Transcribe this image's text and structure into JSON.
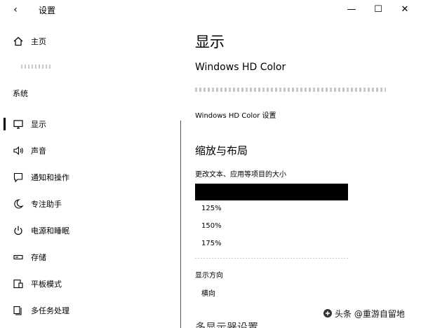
{
  "titlebar": {
    "back_glyph": "‹",
    "title": "设置",
    "minimize_glyph": "—",
    "maximize_glyph": "☐",
    "close_glyph": "✕"
  },
  "sidebar": {
    "home_label": "主页",
    "section_label": "系统",
    "items": [
      {
        "label": "显示",
        "icon": "monitor-icon",
        "active": true
      },
      {
        "label": "声音",
        "icon": "speaker-icon"
      },
      {
        "label": "通知和操作",
        "icon": "notification-icon"
      },
      {
        "label": "专注助手",
        "icon": "moon-icon"
      },
      {
        "label": "电源和睡眠",
        "icon": "power-icon"
      },
      {
        "label": "存储",
        "icon": "storage-icon"
      },
      {
        "label": "平板模式",
        "icon": "tablet-icon"
      },
      {
        "label": "多任务处理",
        "icon": "multitask-icon"
      }
    ]
  },
  "main": {
    "page_title": "显示",
    "hd_title": "Windows HD Color",
    "hd_link": "Windows HD Color 设置",
    "scale_title": "缩放与布局",
    "scale_label": "更改文本、应用等项目的大小",
    "scale_options": [
      "",
      "125%",
      "150%",
      "175%"
    ],
    "orientation_label": "显示方向",
    "orientation_value": "横向",
    "multi_title": "多显示器设置"
  },
  "watermark": {
    "text": "头条 @重游自留地"
  },
  "colors": {
    "accent": "#000000",
    "background": "#ffffff"
  }
}
